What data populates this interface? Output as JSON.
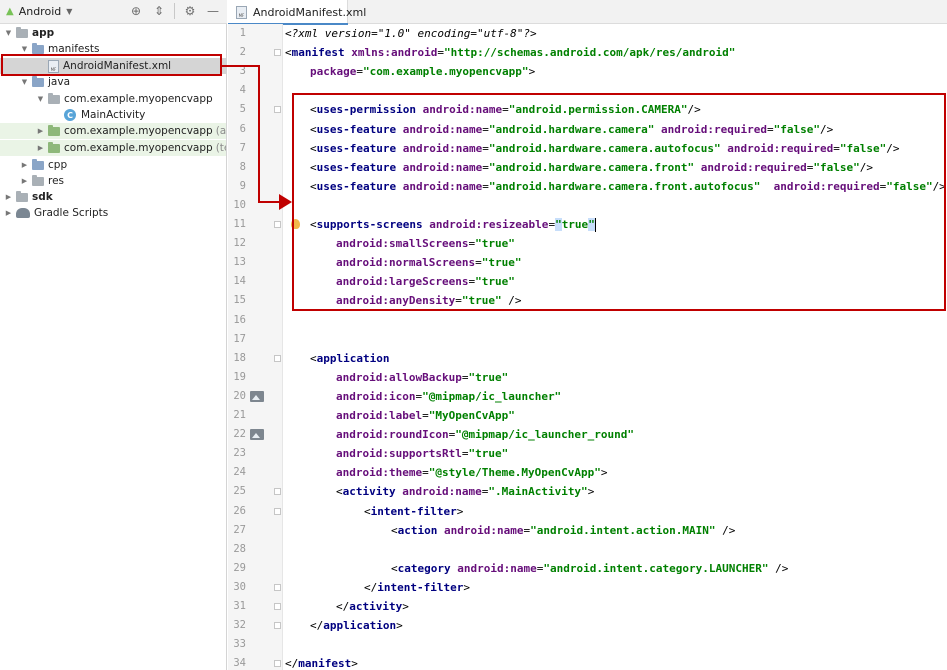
{
  "project_panel": {
    "view_label": "Android",
    "icons": [
      "target-icon",
      "collapse-icon",
      "gear-icon",
      "hide-icon"
    ],
    "tree": [
      {
        "label": "app",
        "bold": true,
        "depth": 0,
        "expanded": true,
        "icon": "module",
        "tinted": false
      },
      {
        "label": "manifests",
        "depth": 1,
        "expanded": true,
        "icon": "folder-blue"
      },
      {
        "label": "AndroidManifest.xml",
        "depth": 2,
        "icon": "manifest-file",
        "selected": true
      },
      {
        "label": "java",
        "depth": 1,
        "expanded": true,
        "icon": "folder-blue"
      },
      {
        "label": "com.example.myopencvapp",
        "depth": 2,
        "expanded": true,
        "icon": "folder-gray"
      },
      {
        "label": "MainActivity",
        "depth": 3,
        "icon": "class"
      },
      {
        "label": "com.example.myopencvapp",
        "suffix": "(androidTest)",
        "depth": 2,
        "expanded": false,
        "icon": "folder-green",
        "tinted": true
      },
      {
        "label": "com.example.myopencvapp",
        "suffix": "(test)",
        "depth": 2,
        "expanded": false,
        "icon": "folder-green",
        "tinted": true
      },
      {
        "label": "cpp",
        "depth": 1,
        "expanded": false,
        "icon": "folder-blue"
      },
      {
        "label": "res",
        "depth": 1,
        "expanded": false,
        "icon": "folder-gray"
      },
      {
        "label": "sdk",
        "bold": true,
        "depth": 0,
        "expanded": false,
        "icon": "module"
      },
      {
        "label": "Gradle Scripts",
        "depth": 0,
        "expanded": false,
        "icon": "gradle"
      }
    ]
  },
  "editor": {
    "tab_label": "AndroidManifest.xml",
    "line_numbers": [
      "1",
      "2",
      "3",
      "4",
      "5",
      "6",
      "7",
      "8",
      "9",
      "10",
      "11",
      "12",
      "13",
      "14",
      "15",
      "16",
      "17",
      "18",
      "19",
      "20",
      "21",
      "22",
      "23",
      "24",
      "25",
      "26",
      "27",
      "28",
      "29",
      "30",
      "31",
      "32",
      "33",
      "34"
    ],
    "lines": [
      {
        "indent": 0,
        "tokens": [
          [
            "pi",
            "<?xml version=\"1.0\" encoding=\"utf-8\"?>"
          ]
        ]
      },
      {
        "indent": 0,
        "tokens": [
          [
            "p",
            "<"
          ],
          [
            "t",
            "manifest "
          ],
          [
            "a",
            "xmlns:android"
          ],
          [
            "p",
            "="
          ],
          [
            "v",
            "\"http://schemas.android.com/apk/res/android\""
          ]
        ]
      },
      {
        "indent": 1,
        "tokens": [
          [
            "a",
            "package"
          ],
          [
            "p",
            "="
          ],
          [
            "v",
            "\"com.example.myopencvapp\""
          ],
          [
            "p",
            ">"
          ]
        ]
      },
      {
        "indent": 0,
        "tokens": []
      },
      {
        "indent": 1,
        "tokens": [
          [
            "p",
            "<"
          ],
          [
            "t",
            "uses-permission "
          ],
          [
            "a",
            "android:name"
          ],
          [
            "p",
            "="
          ],
          [
            "v",
            "\"android.permission.CAMERA\""
          ],
          [
            "p",
            "/>"
          ]
        ]
      },
      {
        "indent": 1,
        "tokens": [
          [
            "p",
            "<"
          ],
          [
            "t",
            "uses-feature "
          ],
          [
            "a",
            "android:name"
          ],
          [
            "p",
            "="
          ],
          [
            "v",
            "\"android.hardware.camera\" "
          ],
          [
            "a",
            "android:required"
          ],
          [
            "p",
            "="
          ],
          [
            "v",
            "\"false\""
          ],
          [
            "p",
            "/>"
          ]
        ]
      },
      {
        "indent": 1,
        "tokens": [
          [
            "p",
            "<"
          ],
          [
            "t",
            "uses-feature "
          ],
          [
            "a",
            "android:name"
          ],
          [
            "p",
            "="
          ],
          [
            "v",
            "\"android.hardware.camera.autofocus\" "
          ],
          [
            "a",
            "android:required"
          ],
          [
            "p",
            "="
          ],
          [
            "v",
            "\"false\""
          ],
          [
            "p",
            "/>"
          ]
        ]
      },
      {
        "indent": 1,
        "tokens": [
          [
            "p",
            "<"
          ],
          [
            "t",
            "uses-feature "
          ],
          [
            "a",
            "android:name"
          ],
          [
            "p",
            "="
          ],
          [
            "v",
            "\"android.hardware.camera.front\" "
          ],
          [
            "a",
            "android:required"
          ],
          [
            "p",
            "="
          ],
          [
            "v",
            "\"false\""
          ],
          [
            "p",
            "/>"
          ]
        ]
      },
      {
        "indent": 1,
        "tokens": [
          [
            "p",
            "<"
          ],
          [
            "t",
            "uses-feature "
          ],
          [
            "a",
            "android:name"
          ],
          [
            "p",
            "="
          ],
          [
            "v",
            "\"android.hardware.camera.front.autofocus\"  "
          ],
          [
            "a",
            "android:required"
          ],
          [
            "p",
            "="
          ],
          [
            "v",
            "\"false\""
          ],
          [
            "p",
            "/>"
          ]
        ]
      },
      {
        "indent": 0,
        "tokens": []
      },
      {
        "indent": 1,
        "tokens": [
          [
            "p",
            "<"
          ],
          [
            "t",
            "supports-screens "
          ],
          [
            "a",
            "android:resizeable"
          ],
          [
            "p",
            "="
          ],
          [
            "vh",
            "\""
          ],
          [
            "v",
            "true"
          ],
          [
            "vh",
            "\""
          ],
          [
            "caret",
            ""
          ]
        ]
      },
      {
        "indent": 2,
        "tokens": [
          [
            "a",
            "android:smallScreens"
          ],
          [
            "p",
            "="
          ],
          [
            "v",
            "\"true\""
          ]
        ]
      },
      {
        "indent": 2,
        "tokens": [
          [
            "a",
            "android:normalScreens"
          ],
          [
            "p",
            "="
          ],
          [
            "v",
            "\"true\""
          ]
        ]
      },
      {
        "indent": 2,
        "tokens": [
          [
            "a",
            "android:largeScreens"
          ],
          [
            "p",
            "="
          ],
          [
            "v",
            "\"true\""
          ]
        ]
      },
      {
        "indent": 2,
        "tokens": [
          [
            "a",
            "android:anyDensity"
          ],
          [
            "p",
            "="
          ],
          [
            "v",
            "\"true\""
          ],
          [
            "p",
            " />"
          ]
        ]
      },
      {
        "indent": 0,
        "tokens": []
      },
      {
        "indent": 0,
        "tokens": []
      },
      {
        "indent": 1,
        "tokens": [
          [
            "p",
            "<"
          ],
          [
            "t",
            "application"
          ]
        ]
      },
      {
        "indent": 2,
        "tokens": [
          [
            "a",
            "android:allowBackup"
          ],
          [
            "p",
            "="
          ],
          [
            "v",
            "\"true\""
          ]
        ]
      },
      {
        "indent": 2,
        "tokens": [
          [
            "a",
            "android:icon"
          ],
          [
            "p",
            "="
          ],
          [
            "v",
            "\"@mipmap/ic_launcher\""
          ]
        ]
      },
      {
        "indent": 2,
        "tokens": [
          [
            "a",
            "android:label"
          ],
          [
            "p",
            "="
          ],
          [
            "v",
            "\"MyOpenCvApp\""
          ]
        ]
      },
      {
        "indent": 2,
        "tokens": [
          [
            "a",
            "android:roundIcon"
          ],
          [
            "p",
            "="
          ],
          [
            "v",
            "\"@mipmap/ic_launcher_round\""
          ]
        ]
      },
      {
        "indent": 2,
        "tokens": [
          [
            "a",
            "android:supportsRtl"
          ],
          [
            "p",
            "="
          ],
          [
            "v",
            "\"true\""
          ]
        ]
      },
      {
        "indent": 2,
        "tokens": [
          [
            "a",
            "android:theme"
          ],
          [
            "p",
            "="
          ],
          [
            "v",
            "\"@style/Theme.MyOpenCvApp\""
          ],
          [
            "p",
            ">"
          ]
        ]
      },
      {
        "indent": 2,
        "tokens": [
          [
            "p",
            "<"
          ],
          [
            "t",
            "activity "
          ],
          [
            "a",
            "android:name"
          ],
          [
            "p",
            "="
          ],
          [
            "v",
            "\".MainActivity\""
          ],
          [
            "p",
            ">"
          ]
        ]
      },
      {
        "indent": 3,
        "tokens": [
          [
            "p",
            "<"
          ],
          [
            "t",
            "intent-filter"
          ],
          [
            "p",
            ">"
          ]
        ]
      },
      {
        "indent": 4,
        "tokens": [
          [
            "p",
            "<"
          ],
          [
            "t",
            "action "
          ],
          [
            "a",
            "android:name"
          ],
          [
            "p",
            "="
          ],
          [
            "v",
            "\"android.intent.action.MAIN\""
          ],
          [
            "p",
            " />"
          ]
        ]
      },
      {
        "indent": 0,
        "tokens": []
      },
      {
        "indent": 4,
        "tokens": [
          [
            "p",
            "<"
          ],
          [
            "t",
            "category "
          ],
          [
            "a",
            "android:name"
          ],
          [
            "p",
            "="
          ],
          [
            "v",
            "\"android.intent.category.LAUNCHER\""
          ],
          [
            "p",
            " />"
          ]
        ]
      },
      {
        "indent": 3,
        "tokens": [
          [
            "p",
            "</"
          ],
          [
            "t",
            "intent-filter"
          ],
          [
            "p",
            ">"
          ]
        ]
      },
      {
        "indent": 2,
        "tokens": [
          [
            "p",
            "</"
          ],
          [
            "t",
            "activity"
          ],
          [
            "p",
            ">"
          ]
        ]
      },
      {
        "indent": 1,
        "tokens": [
          [
            "p",
            "</"
          ],
          [
            "t",
            "application"
          ],
          [
            "p",
            ">"
          ]
        ]
      },
      {
        "indent": 0,
        "tokens": []
      },
      {
        "indent": 0,
        "tokens": [
          [
            "p",
            "</"
          ],
          [
            "t",
            "manifest"
          ],
          [
            "p",
            ">"
          ]
        ]
      }
    ],
    "fold_markers": [
      2,
      5,
      11,
      18,
      25,
      26,
      30,
      31,
      32,
      34
    ],
    "image_gutter_lines": [
      20,
      22
    ],
    "bulb_line": 11
  },
  "colors": {
    "annotation_red": "#c00000",
    "tag": "#000080",
    "attribute": "#660e7a",
    "value": "#008000"
  }
}
